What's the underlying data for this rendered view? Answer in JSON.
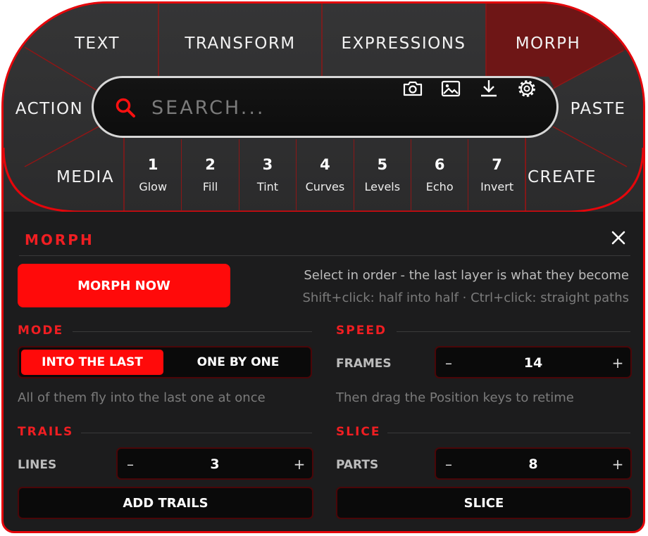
{
  "wheel": {
    "top": [
      "TEXT",
      "TRANSFORM",
      "EXPRESSIONS",
      "MORPH"
    ],
    "left": [
      "ACTION",
      "MEDIA"
    ],
    "right": [
      "PASTE",
      "CREATE"
    ],
    "active": "MORPH"
  },
  "search": {
    "placeholder": "SEARCH..."
  },
  "presets": [
    {
      "n": "1",
      "label": "Glow"
    },
    {
      "n": "2",
      "label": "Fill"
    },
    {
      "n": "3",
      "label": "Tint"
    },
    {
      "n": "4",
      "label": "Curves"
    },
    {
      "n": "5",
      "label": "Levels"
    },
    {
      "n": "6",
      "label": "Echo"
    },
    {
      "n": "7",
      "label": "Invert"
    }
  ],
  "panel": {
    "title": "MORPH",
    "primary_button": "MORPH NOW",
    "hint_line1": "Select in order - the last layer is what they become",
    "hint_line2": "Shift+click: half into half  ·  Ctrl+click: straight paths"
  },
  "mode": {
    "heading": "MODE",
    "options": [
      "INTO THE LAST",
      "ONE BY ONE"
    ],
    "selected": "INTO THE LAST",
    "description": "All of them fly into the last one at once"
  },
  "speed": {
    "heading": "SPEED",
    "label": "FRAMES",
    "value": "14",
    "description": "Then drag the Position keys to retime"
  },
  "trails": {
    "heading": "TRAILS",
    "label": "LINES",
    "value": "3",
    "button": "ADD TRAILS"
  },
  "slice": {
    "heading": "SLICE",
    "label": "PARTS",
    "value": "8",
    "button": "SLICE"
  },
  "stepper_symbols": {
    "minus": "–",
    "plus": "+"
  },
  "colors": {
    "accent": "#ff0a0a",
    "active_segment": "#6e1616",
    "panel_bg": "#1c1c1d"
  }
}
